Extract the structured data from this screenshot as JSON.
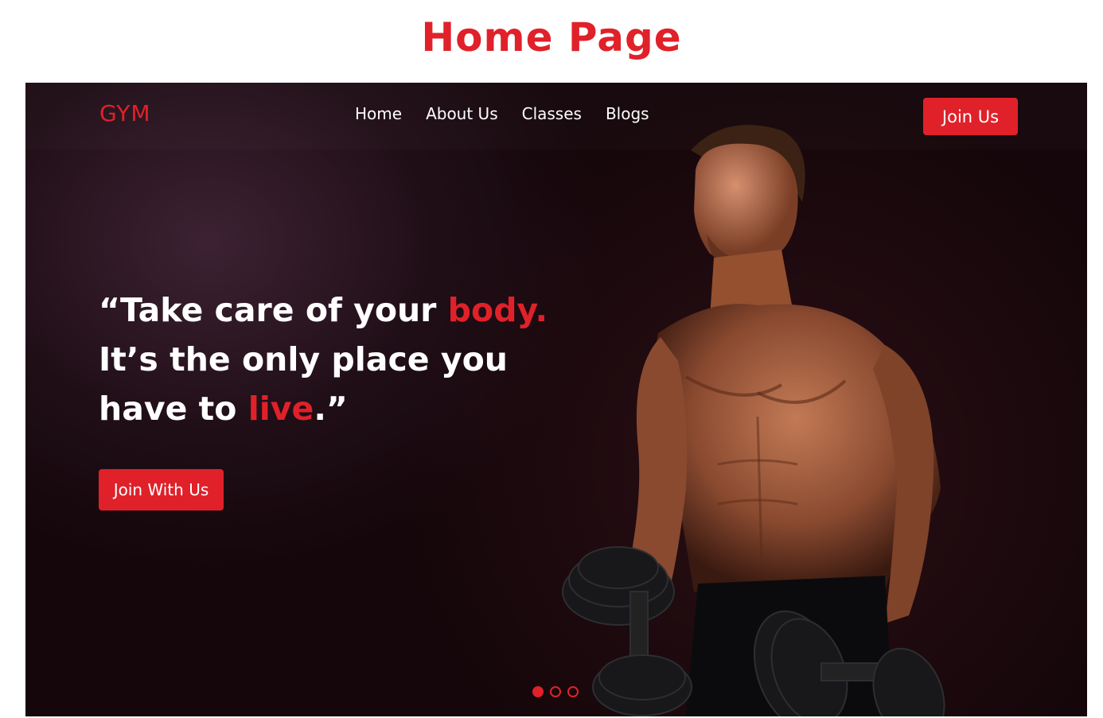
{
  "page_heading": "Home Page",
  "header": {
    "logo": "GYM",
    "nav": [
      {
        "label": "Home",
        "active": true
      },
      {
        "label": "About Us",
        "active": false
      },
      {
        "label": "Classes",
        "active": false
      },
      {
        "label": "Blogs",
        "active": false
      }
    ],
    "join_button": "Join Us"
  },
  "hero": {
    "quote_lines": [
      {
        "parts": [
          {
            "text": "“Take care of your ",
            "accent": false
          },
          {
            "text": "body.",
            "accent": true
          }
        ]
      },
      {
        "parts": [
          {
            "text": "It’s the only place you",
            "accent": false
          }
        ]
      },
      {
        "parts": [
          {
            "text": "have to ",
            "accent": false
          },
          {
            "text": "live",
            "accent": true
          },
          {
            "text": ".”",
            "accent": false
          }
        ]
      }
    ],
    "cta_button": "Join With Us",
    "carousel": {
      "count": 3,
      "active_index": 0
    }
  },
  "colors": {
    "accent": "#e0212a",
    "hero_background": "#120508",
    "text_light": "#ffffff"
  },
  "icons": [
    "muscular-man-with-dumbbells-photo"
  ]
}
